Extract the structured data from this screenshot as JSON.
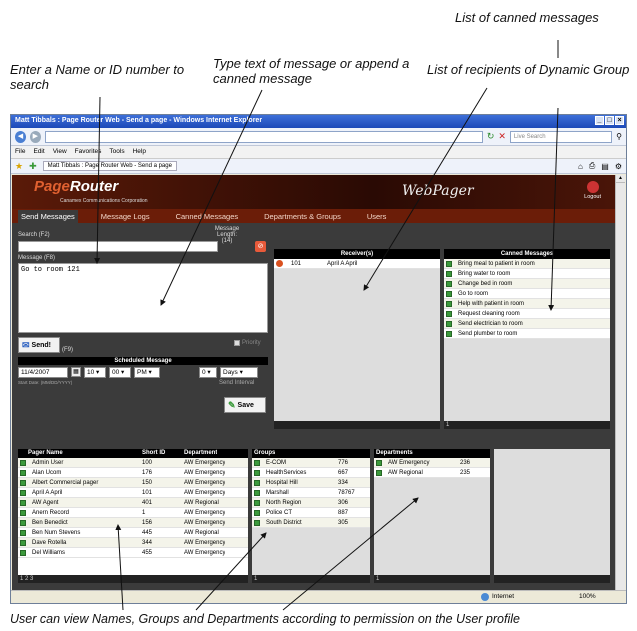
{
  "annotations": {
    "search": "Enter a Name or ID number to search",
    "type_text": "Type text of message or append a canned message",
    "canned": "List of canned messages",
    "recipients": "List of recipients of Dynamic Group",
    "bottom": "User can view Names, Groups and Departments according to permission on the User profile"
  },
  "browser": {
    "title": "Matt Tibbals : Page Router Web - Send a page - Windows Internet Explorer",
    "search_placeholder": "Live Search",
    "menu": [
      "File",
      "Edit",
      "View",
      "Favorites",
      "Tools",
      "Help"
    ],
    "tab": "Matt Tibbals : Page Router Web - Send a page",
    "status_zone": "Internet",
    "zoom": "100%"
  },
  "app": {
    "logo_main": "Page",
    "logo_accent": "Router",
    "tagline": "Canamex Communications Corporation",
    "brand": "WebPager",
    "logout": "Logout",
    "nav": [
      "Send Messages",
      "Message Logs",
      "Canned Messages",
      "Departments & Groups",
      "Users"
    ]
  },
  "form": {
    "search_label": "Search (F2)",
    "msg_length_label": "Message Length:",
    "msg_length_value": "(14)",
    "message_label": "Message (F8)",
    "message_text": "Go to room 121",
    "send_label": "Send!",
    "send_key": "(F9)",
    "priority_label": "Priority",
    "scheduled_title": "Scheduled Message",
    "date": "11/4/2007",
    "hour": "10",
    "minute": "00",
    "ampm": "PM",
    "date_hint": "Start Date: (MM/DD/YYYY)",
    "interval_value": "0",
    "interval_unit": "Days",
    "interval_label": "Send Interval",
    "save_label": "Save"
  },
  "receivers": {
    "title": "Receiver(s)",
    "rows": [
      {
        "id": "101",
        "name": "April A April"
      }
    ]
  },
  "canned": {
    "title": "Canned Messages",
    "items": [
      "Bring meal to patient in room",
      "Bring water to room",
      "Change bed in room",
      "Go to room",
      "Help with patient in room",
      "Request cleaning room",
      "Send electrician to room",
      "Send plumber to room"
    ],
    "footer": "1"
  },
  "pagers": {
    "headers": [
      "Pager Name",
      "Short ID",
      "Department"
    ],
    "rows": [
      [
        "Admin User",
        "100",
        "AW Emergency"
      ],
      [
        "Alan Ucom",
        "176",
        "AW Emergency"
      ],
      [
        "Albert Commercial pager",
        "150",
        "AW Emergency"
      ],
      [
        "April A April",
        "101",
        "AW Emergency"
      ],
      [
        "AW Agent",
        "401",
        "AW Regional"
      ],
      [
        "Anern Record",
        "1",
        "AW Emergency"
      ],
      [
        "Ben Benedict",
        "156",
        "AW Emergency"
      ],
      [
        "Ben Num Stevens",
        "445",
        "AW Regional"
      ],
      [
        "Dave Rotella",
        "344",
        "AW Emergency"
      ],
      [
        "Del Williams",
        "455",
        "AW Emergency"
      ]
    ],
    "footer": "1 2 3"
  },
  "groups": {
    "header": "Groups",
    "rows": [
      [
        "E-COM",
        "776"
      ],
      [
        "HealthServices",
        "667"
      ],
      [
        "Hospital Hill",
        "334"
      ],
      [
        "Marshall",
        "78767"
      ],
      [
        "North Region",
        "306"
      ],
      [
        "Police CT",
        "887"
      ],
      [
        "South District",
        "305"
      ]
    ],
    "footer": "1"
  },
  "departments": {
    "header": "Departments",
    "rows": [
      [
        "AW Emergency",
        "236"
      ],
      [
        "AW Regional",
        "235"
      ]
    ],
    "footer": "1"
  }
}
